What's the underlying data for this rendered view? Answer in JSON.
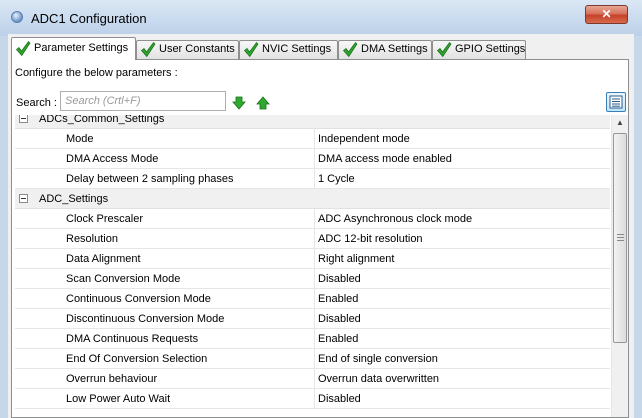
{
  "window": {
    "title": "ADC1 Configuration",
    "close_label": "✕",
    "title_icon": "app-icon"
  },
  "tabs": [
    {
      "label": "Parameter Settings",
      "icon": "check-icon",
      "active": true
    },
    {
      "label": "User Constants",
      "icon": "check-icon",
      "active": false
    },
    {
      "label": "NVIC Settings",
      "icon": "check-icon",
      "active": false
    },
    {
      "label": "DMA Settings",
      "icon": "check-icon",
      "active": false
    },
    {
      "label": "GPIO Settings",
      "icon": "check-icon",
      "active": false
    }
  ],
  "panel": {
    "configure_label": "Configure the below parameters :",
    "search_label": "Search :",
    "search_placeholder": "Search (Crtl+F)",
    "search_value": "",
    "search_down_icon": "green-down-arrow-icon",
    "search_up_icon": "green-up-arrow-icon",
    "view_toggle_icon": "list-view-icon"
  },
  "groups": [
    {
      "label": "ADCs_Common_Settings",
      "expanded": true,
      "params": [
        {
          "name": "Mode",
          "value": "Independent mode"
        },
        {
          "name": "DMA Access Mode",
          "value": "DMA access mode enabled"
        },
        {
          "name": "Delay between 2 sampling phases",
          "value": "1 Cycle"
        }
      ]
    },
    {
      "label": "ADC_Settings",
      "expanded": true,
      "params": [
        {
          "name": "Clock Prescaler",
          "value": "ADC Asynchronous clock mode"
        },
        {
          "name": "Resolution",
          "value": "ADC 12-bit resolution"
        },
        {
          "name": "Data Alignment",
          "value": "Right alignment"
        },
        {
          "name": "Scan Conversion Mode",
          "value": "Disabled"
        },
        {
          "name": "Continuous Conversion Mode",
          "value": "Enabled"
        },
        {
          "name": "Discontinuous Conversion Mode",
          "value": "Disabled"
        },
        {
          "name": "DMA Continuous Requests",
          "value": "Enabled"
        },
        {
          "name": "End Of Conversion Selection",
          "value": "End of single conversion"
        },
        {
          "name": "Overrun behaviour",
          "value": "Overrun data overwritten"
        },
        {
          "name": "Low Power Auto Wait",
          "value": "Disabled"
        }
      ]
    }
  ],
  "colors": {
    "check_green": "#2fa52f",
    "arrow_green": "#1f9e1f",
    "group_row_bg": "#f0f0f0"
  }
}
